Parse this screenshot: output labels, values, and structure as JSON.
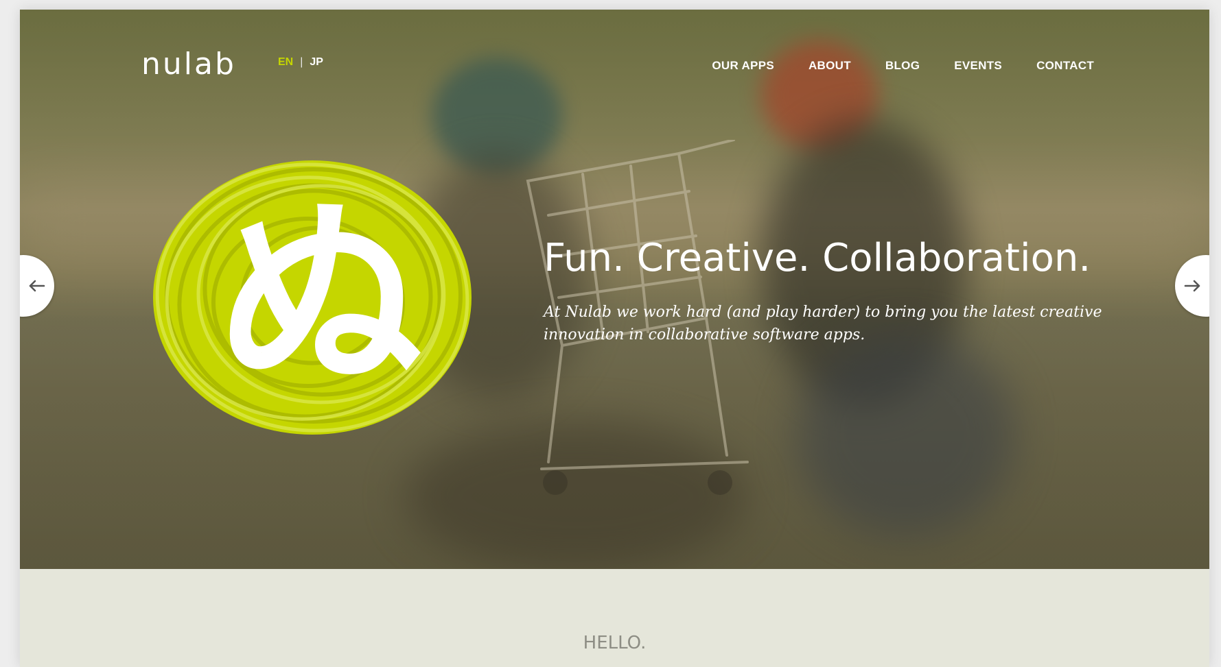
{
  "nav": {
    "brand": "nulab",
    "lang": {
      "en": "EN",
      "separator": "|",
      "jp": "JP"
    },
    "items": [
      "OUR APPS",
      "ABOUT",
      "BLOG",
      "EVENTS",
      "CONTACT"
    ]
  },
  "hero": {
    "emblem_glyph": "ぬ",
    "headline": "Fun. Creative. Collaboration.",
    "subtext": "At Nulab we work hard (and play harder) to bring you the latest creative innovation in collaborative software apps.",
    "prev_icon": "arrow-left-icon",
    "next_icon": "arrow-right-icon"
  },
  "intro": {
    "eyebrow": "HELLO."
  },
  "colors": {
    "accent": "#c5d600",
    "hero_overlay": "#7a7a50",
    "section_bg": "#e5e6da"
  }
}
